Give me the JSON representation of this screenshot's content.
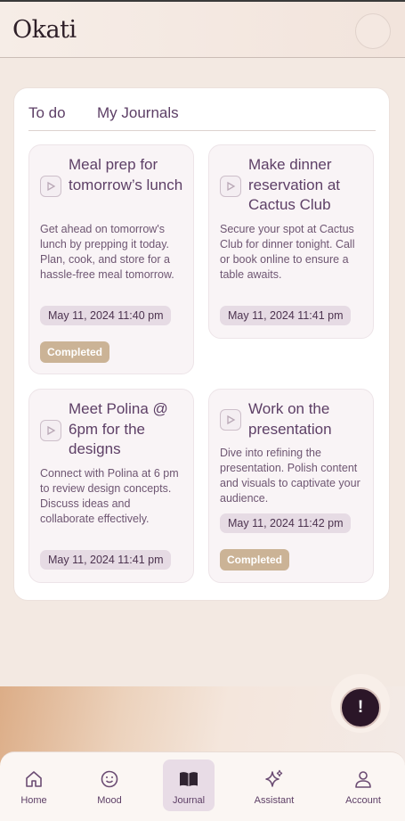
{
  "header": {
    "logo_text": "Okati"
  },
  "tabs": [
    {
      "label": "To do"
    },
    {
      "label": "My Journals"
    }
  ],
  "cards": [
    {
      "title": "Meal prep for tomorrow’s lunch",
      "description": "Get ahead on tomorrow's lunch by prepping it today. Plan, cook, and store for a hassle-free meal tomorrow.",
      "date": "May 11, 2024 11:40 pm",
      "status": "Completed"
    },
    {
      "title": "Make dinner reservation at Cactus Club",
      "description": "Secure your spot at Cactus Club for dinner tonight. Call or book online to ensure a table awaits.",
      "date": "May 11, 2024 11:41 pm",
      "status": ""
    },
    {
      "title": "Meet Polina @ 6pm for the designs",
      "description": "Connect with Polina at 6 pm to review design concepts. Discuss ideas and collaborate effectively.",
      "date": "May 11, 2024 11:41 pm",
      "status": ""
    },
    {
      "title": "Work on the presentation",
      "description": "Dive into refining the presentation. Polish content and visuals to captivate your audience.",
      "date": "May 11, 2024 11:42 pm",
      "status": "Completed"
    }
  ],
  "fab": {
    "label": "!"
  },
  "nav": [
    {
      "label": "Home",
      "icon": "home-icon"
    },
    {
      "label": "Mood",
      "icon": "smiley-icon"
    },
    {
      "label": "Journal",
      "icon": "book-icon",
      "active": true
    },
    {
      "label": "Assistant",
      "icon": "sparkle-icon"
    },
    {
      "label": "Account",
      "icon": "user-icon"
    }
  ],
  "colors": {
    "accent": "#5d3f66",
    "badge": "#cbb396",
    "fab": "#2b1628",
    "background": "#f3e9e2"
  }
}
